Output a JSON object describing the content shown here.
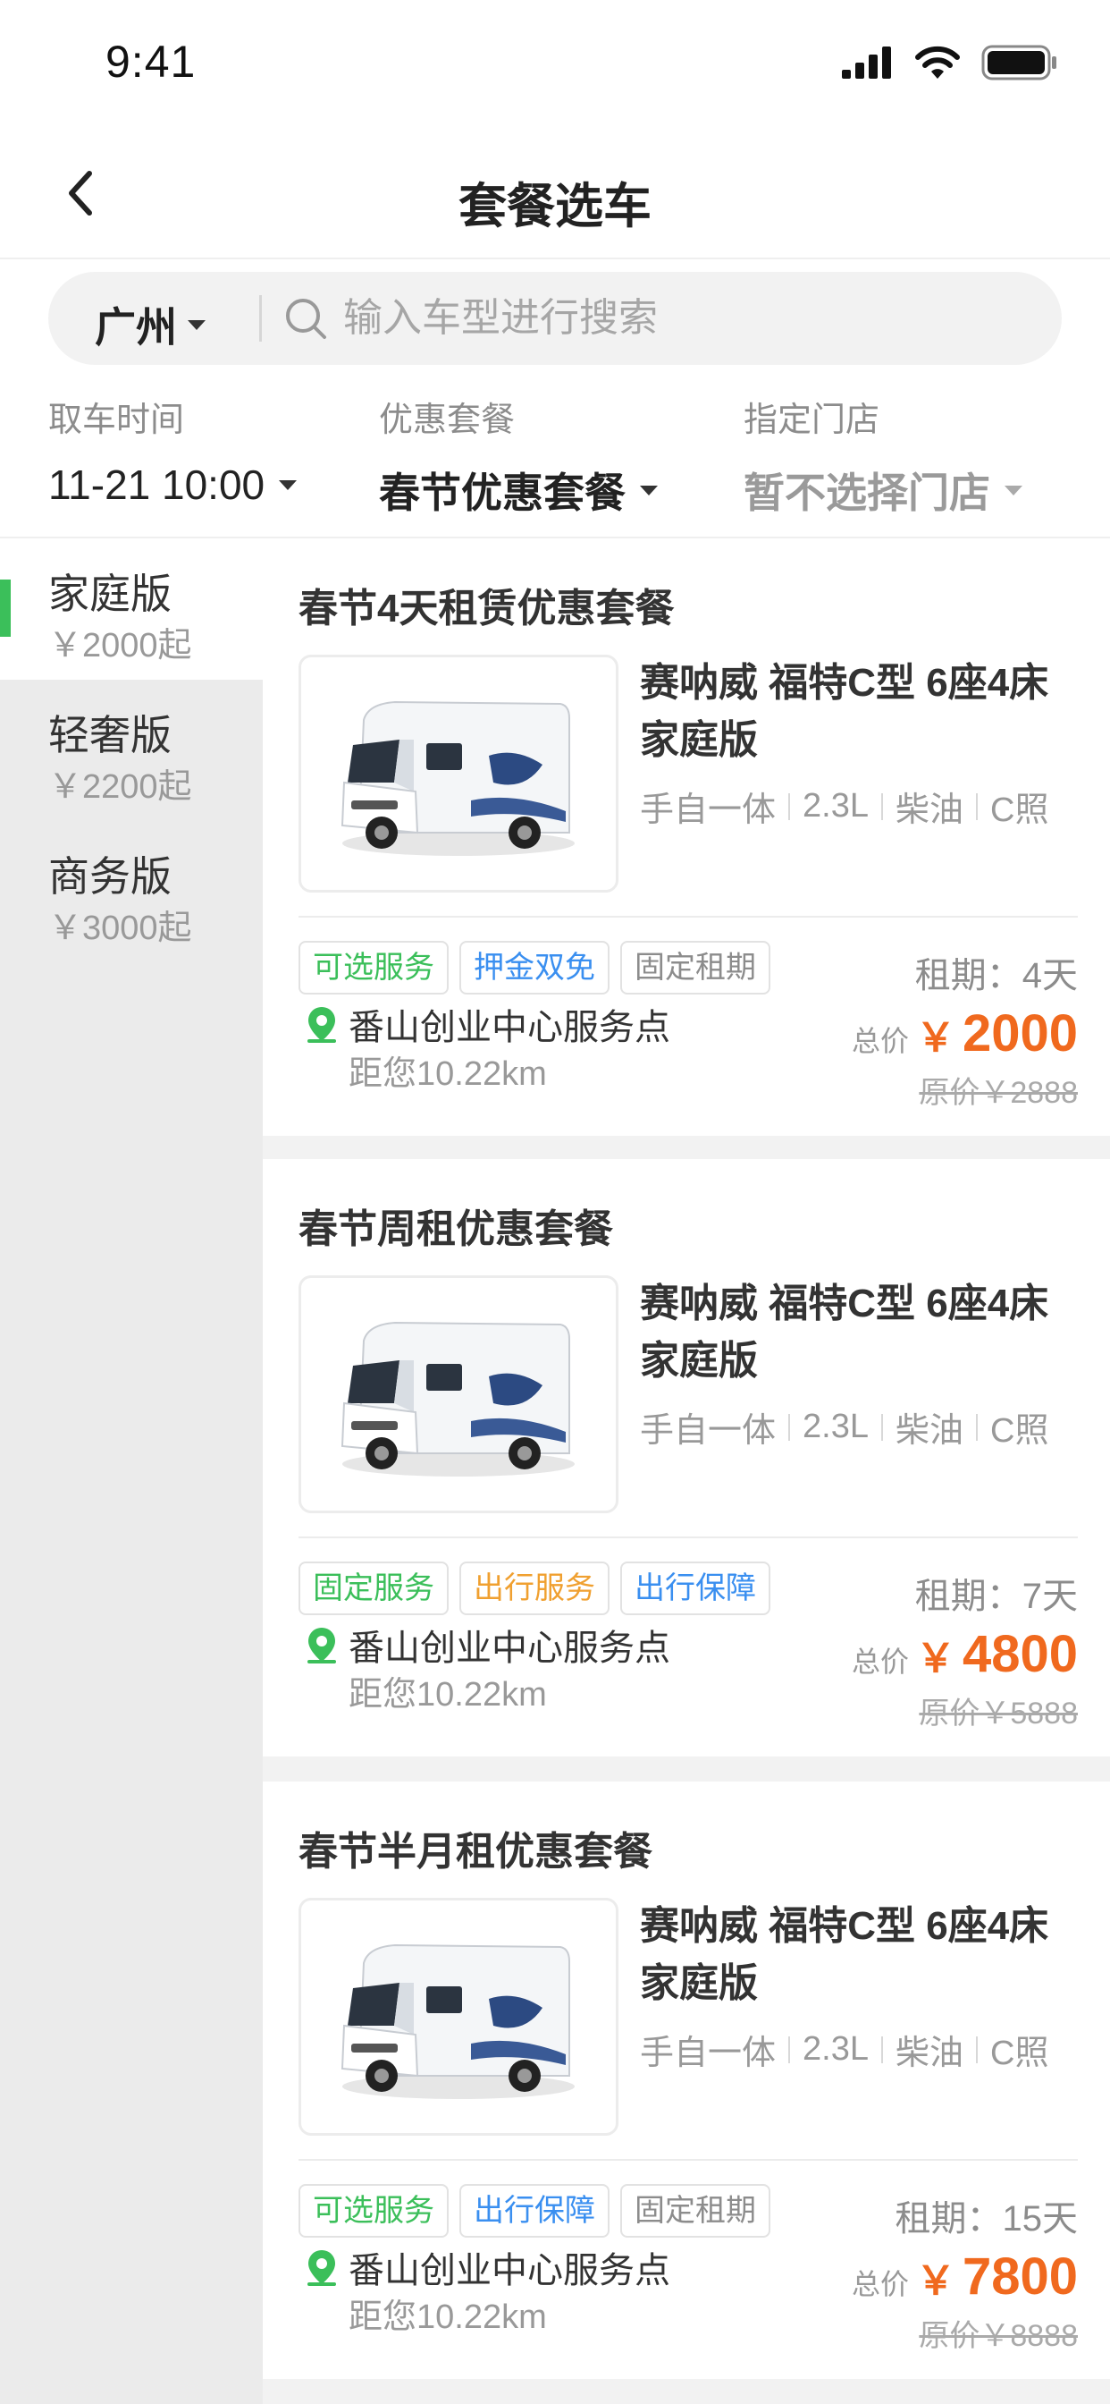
{
  "status_bar": {
    "time": "9:41"
  },
  "nav": {
    "title": "套餐选车"
  },
  "search": {
    "city": "广州",
    "placeholder": "输入车型进行搜索"
  },
  "filters": [
    {
      "label": "取车时间",
      "value": "11-21 10:00"
    },
    {
      "label": "优惠套餐",
      "value": "春节优惠套餐"
    },
    {
      "label": "指定门店",
      "value": "暂不选择门店"
    }
  ],
  "sidebar": {
    "items": [
      {
        "name": "家庭版",
        "price": "￥2000起",
        "active": true
      },
      {
        "name": "轻奢版",
        "price": "￥2200起",
        "active": false
      },
      {
        "name": "商务版",
        "price": "￥3000起",
        "active": false
      }
    ]
  },
  "packages": [
    {
      "title": "春节4天租赁优惠套餐",
      "car_name": "赛呐威 福特C型 6座4床 家庭版",
      "specs": [
        "手自一体",
        "2.3L",
        "柴油",
        "C照"
      ],
      "tags": [
        {
          "text": "可选服务",
          "color": "green"
        },
        {
          "text": "押金双免",
          "color": "blue"
        },
        {
          "text": "固定租期",
          "color": "grey"
        }
      ],
      "store": "番山创业中心服务点",
      "distance": "距您10.22km",
      "period": "租期：4天",
      "price_label": "总价",
      "yen": "￥",
      "price": "2000",
      "original": "原价￥2888"
    },
    {
      "title": "春节周租优惠套餐",
      "car_name": "赛呐威 福特C型 6座4床 家庭版",
      "specs": [
        "手自一体",
        "2.3L",
        "柴油",
        "C照"
      ],
      "tags": [
        {
          "text": "固定服务",
          "color": "green"
        },
        {
          "text": "出行服务",
          "color": "orange"
        },
        {
          "text": "出行保障",
          "color": "blue"
        }
      ],
      "store": "番山创业中心服务点",
      "distance": "距您10.22km",
      "period": "租期：7天",
      "price_label": "总价",
      "yen": "￥",
      "price": "4800",
      "original": "原价￥5888"
    },
    {
      "title": "春节半月租优惠套餐",
      "car_name": "赛呐威 福特C型 6座4床 家庭版",
      "specs": [
        "手自一体",
        "2.3L",
        "柴油",
        "C照"
      ],
      "tags": [
        {
          "text": "可选服务",
          "color": "green"
        },
        {
          "text": "出行保障",
          "color": "blue"
        },
        {
          "text": "固定租期",
          "color": "grey"
        }
      ],
      "store": "番山创业中心服务点",
      "distance": "距您10.22km",
      "period": "租期：15天",
      "price_label": "总价",
      "yen": "￥",
      "price": "7800",
      "original": "原价￥8888"
    }
  ],
  "colors": {
    "accent_green": "#3bbf5a",
    "price_orange": "#f0691e",
    "tag_blue": "#3a8ff0",
    "tag_orange": "#f0a030"
  },
  "icons": [
    "back-chevron-icon",
    "search-icon",
    "location-pin-icon",
    "signal-icon",
    "wifi-icon",
    "battery-icon",
    "dropdown-triangle-icon"
  ]
}
